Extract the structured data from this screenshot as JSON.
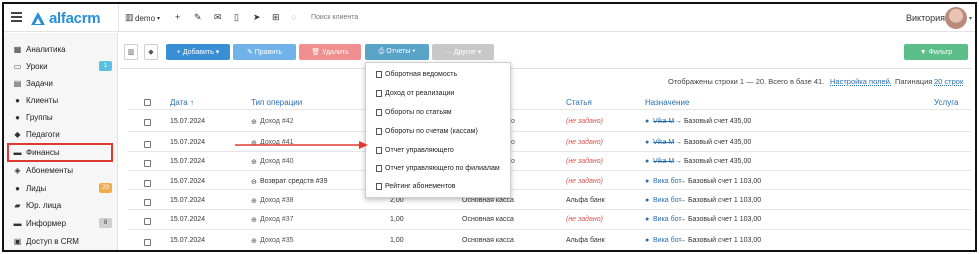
{
  "topbar": {
    "logo": "alfacrm",
    "branch": "demo",
    "search_placeholder": "Поиск клиента",
    "user_name": "Виктория",
    "tools": [
      "plus",
      "wrench",
      "mail",
      "phone",
      "send",
      "cart",
      "bulb"
    ]
  },
  "sidebar": {
    "items": [
      {
        "label": "Аналитика",
        "icon": "analytics-icon"
      },
      {
        "label": "Уроки",
        "icon": "calendar-icon",
        "badge": "1",
        "badge_color": "#5bc0de"
      },
      {
        "label": "Задачи",
        "icon": "tasks-icon"
      },
      {
        "label": "Клиенты",
        "icon": "user-icon"
      },
      {
        "label": "Группы",
        "icon": "users-icon"
      },
      {
        "label": "Педагоги",
        "icon": "graduation-icon"
      },
      {
        "label": "Финансы",
        "icon": "money-icon",
        "active": true
      },
      {
        "label": "Абонементы",
        "icon": "tag-icon"
      },
      {
        "label": "Лиды",
        "icon": "lead-icon",
        "badge": "20",
        "badge_color": "#f0ad4e"
      },
      {
        "label": "Юр. лица",
        "icon": "briefcase-icon"
      },
      {
        "label": "Информер",
        "icon": "informer-icon",
        "badge": "8",
        "badge_color": "#bbbbbb"
      },
      {
        "label": "Доступ в CRM",
        "icon": "lock-icon"
      }
    ]
  },
  "toolbar": {
    "add": "+ Добавить ▾",
    "edit": "✎ Править",
    "delete": "🗑 Удалить",
    "reports": "⎙ Отчеты ▾",
    "other": "··· Другое ▾",
    "filter": "▼ Фильтр",
    "colors": {
      "add": "#3a8ed6",
      "edit": "#6fb3e8",
      "delete": "#ef8f8f",
      "reports": "#5aa3c9",
      "other": "#c8c8c8",
      "filter": "#5cbf8a"
    }
  },
  "info": {
    "shown": "Отображены строки 1 — 20. Всего в базе 41.",
    "settings": "Настройка полей.",
    "pagination_label": "Пагинация",
    "pagination_value": "20 строк"
  },
  "table": {
    "headers": {
      "date": "Дата ↑",
      "type": "Тип операции",
      "article": "Статья",
      "purpose": "Назначение",
      "service": "Услуга"
    },
    "rows": [
      {
        "date": "15.07.2024",
        "type": "Доход #42",
        "sum": "",
        "cash": "",
        "article": "(не задано)",
        "from": "Vika M",
        "from_strike": true,
        "to": "→ Базовый счет 435,00"
      },
      {
        "date": "15.07.2024",
        "type": "Доход #41",
        "sum": "",
        "cash": "",
        "article": "(не задано)",
        "from": "Vika M",
        "from_strike": true,
        "to": "→ Базовый счет 435,00"
      },
      {
        "date": "15.07.2024",
        "type": "Доход #40",
        "sum": "",
        "cash": "",
        "article": "(не задано)",
        "from": "Vika M",
        "from_strike": true,
        "to": "→ Базовый счет 435,00"
      },
      {
        "date": "15.07.2024",
        "type": "Возврат средств #39",
        "sum": "",
        "cash": "",
        "article": "(не задано)",
        "from": "Вика бот",
        "from_strike": false,
        "to": "→ Базовый счет 1 103,00"
      },
      {
        "date": "15.07.2024",
        "type": "Доход #38",
        "sum": "2,00",
        "cash": "Основная касса",
        "article": "Альфа банк",
        "from": "Вика бот",
        "from_strike": false,
        "to": "→ Базовый счет 1 103,00"
      },
      {
        "date": "15.07.2024",
        "type": "Доход #37",
        "sum": "1,00",
        "cash": "Основная касса",
        "article": "(не задано)",
        "from": "Вика бот",
        "from_strike": false,
        "to": "→ Базовый счет 1 103,00"
      },
      {
        "date": "15.07.2024",
        "type": "Доход #35",
        "sum": "1,00",
        "cash": "Основная касса",
        "article": "Альфа банк",
        "from": "Вика бот",
        "from_strike": false,
        "to": "→ Базовый счет 1 103,00"
      }
    ],
    "partial_o": "о"
  },
  "reports_menu": {
    "items": [
      "Оборотная ведомость",
      "Доход от реализации",
      "Обороты по статьям",
      "Обороты по счетам (кассам)",
      "Отчет управляющего",
      "Отчет управляющего по филиалам",
      "Рейтинг абонементов"
    ]
  }
}
